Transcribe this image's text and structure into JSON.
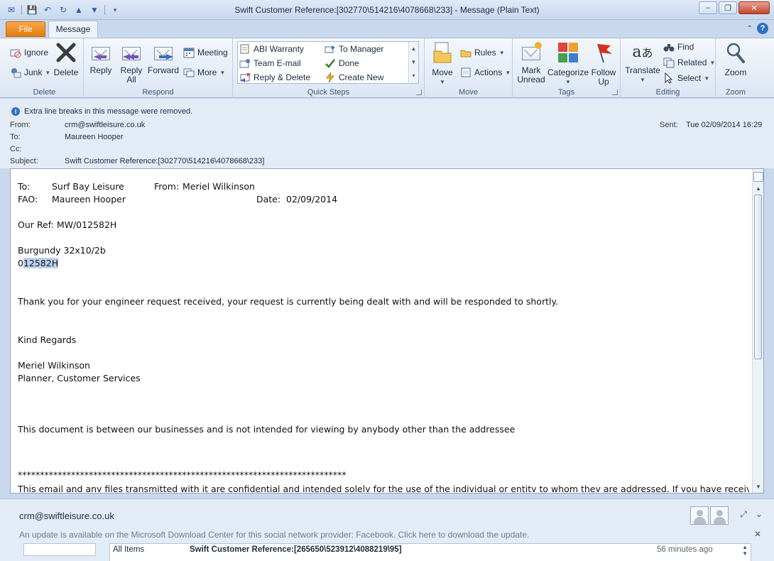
{
  "window": {
    "title": "Swift Customer Reference:[302770\\514216\\4078668\\233]  -  Message (Plain Text)",
    "controls": {
      "minimize": "–",
      "restore": "❐",
      "close": "✕"
    }
  },
  "tabs": {
    "file": "File",
    "message": "Message",
    "help": "?"
  },
  "ribbon": {
    "delete_group": {
      "label": "Delete",
      "ignore": "Ignore",
      "junk": "Junk",
      "delete": "Delete"
    },
    "respond_group": {
      "label": "Respond",
      "reply": "Reply",
      "reply_all_1": "Reply",
      "reply_all_2": "All",
      "forward": "Forward",
      "meeting": "Meeting",
      "more": "More"
    },
    "quick_steps": {
      "label": "Quick Steps",
      "items": [
        "ABI Warranty",
        "Team E-mail",
        "Reply & Delete",
        "To Manager",
        "Done",
        "Create New"
      ]
    },
    "move_group": {
      "label": "Move",
      "move": "Move",
      "rules": "Rules",
      "actions": "Actions"
    },
    "tags_group": {
      "label": "Tags",
      "mark_unread_1": "Mark",
      "mark_unread_2": "Unread",
      "categorize": "Categorize",
      "follow_up_1": "Follow",
      "follow_up_2": "Up"
    },
    "editing_group": {
      "label": "Editing",
      "translate": "Translate",
      "find": "Find",
      "related": "Related",
      "select": "Select"
    },
    "zoom_group": {
      "label": "Zoom",
      "zoom": "Zoom"
    }
  },
  "header": {
    "infobar": "Extra line breaks in this message were removed.",
    "from_label": "From:",
    "from": "crm@swiftleisure.co.uk",
    "to_label": "To:",
    "to": "Maureen Hooper",
    "cc_label": "Cc:",
    "cc": "",
    "subject_label": "Subject:",
    "subject": "Swift Customer Reference:[302770\\514216\\4078668\\233]",
    "sent_label": "Sent:",
    "sent": "Tue 02/09/2014 16:29"
  },
  "body": {
    "to_label": "To:",
    "to_value": "Surf Bay Leisure",
    "from_label": "From:",
    "from_value": "Meriel Wilkinson",
    "fao_label": "FAO:",
    "fao_value": "Maureen Hooper",
    "date_label": "Date:",
    "date_value": "02/09/2014",
    "our_ref": "Our Ref: MW/012582H",
    "product": "Burgundy 32x10/2b",
    "ref_prefix": "0",
    "ref_selected": "12582H",
    "message": "Thank you for your engineer request received, your request is currently being dealt with and will be responded to shortly.",
    "regards": "Kind Regards",
    "sender_name": "Meriel Wilkinson",
    "sender_title": "Planner, Customer Services",
    "notice": "This document is between our businesses and is not intended for viewing by anybody other than the addressee",
    "stars": "**************************************************************************",
    "disclaimer": "This email and any files transmitted with it are confidential and intended solely for the use of the individual or entity to whom they are addressed. If you have received"
  },
  "people_pane": {
    "name": "crm@swiftleisure.co.uk",
    "update": "An update is available on the Microsoft Download Center for this social network provider: Facebook. Click here to download the update.",
    "all_items": "All Items",
    "item_subject": "Swift Customer Reference:[265650\\523912\\4088219\\95]",
    "item_time": "56 minutes ago"
  }
}
